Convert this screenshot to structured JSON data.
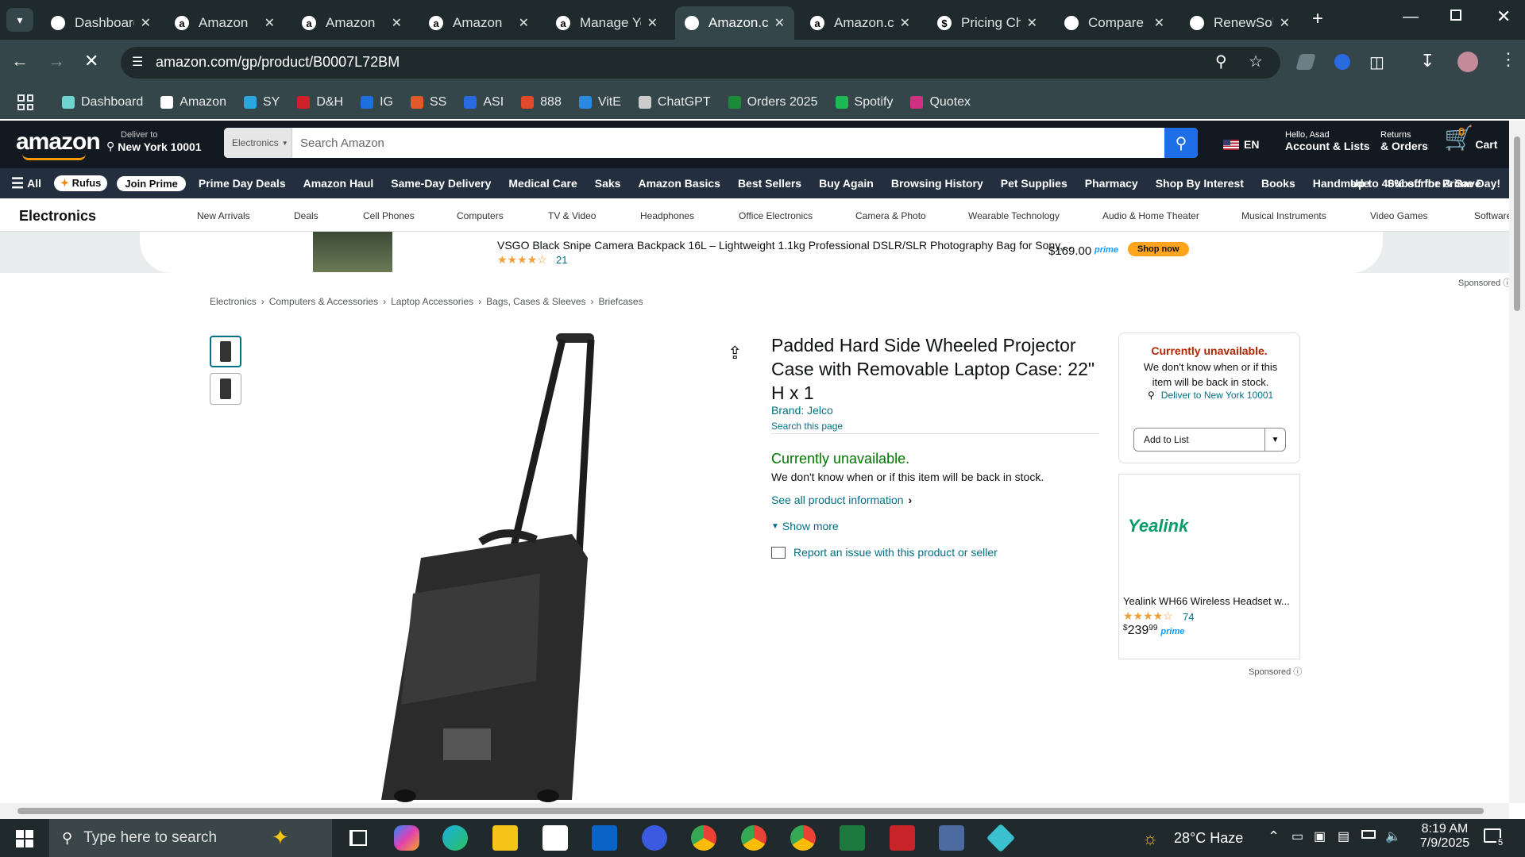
{
  "browser": {
    "tabs": [
      {
        "title": "Dashboard",
        "icon": "dashboard-icon"
      },
      {
        "title": "Amazon",
        "icon": "amazon-icon"
      },
      {
        "title": "Amazon",
        "icon": "amazon-icon"
      },
      {
        "title": "Amazon",
        "icon": "amazon-icon"
      },
      {
        "title": "Manage Yo",
        "icon": "amazon-icon"
      },
      {
        "title": "Amazon.co",
        "icon": "loading-icon"
      },
      {
        "title": "Amazon.co",
        "icon": "amazon-icon"
      },
      {
        "title": "Pricing Ch",
        "icon": "dollar-icon"
      },
      {
        "title": "Compare (",
        "icon": "compare-icon"
      },
      {
        "title": "RenewSolu",
        "icon": "ec-icon"
      }
    ],
    "active_tab_index": 5,
    "url": "amazon.com/gp/product/B0007L72BM",
    "bookmarks": [
      {
        "label": "Dashboard",
        "color": "#6fd3d0"
      },
      {
        "label": "Amazon",
        "color": "#ffffff"
      },
      {
        "label": "SY",
        "color": "#2aa7df"
      },
      {
        "label": "D&H",
        "color": "#d0202a"
      },
      {
        "label": "IG",
        "color": "#1e6ee0"
      },
      {
        "label": "SS",
        "color": "#e05a2a"
      },
      {
        "label": "ASI",
        "color": "#2a6ae0"
      },
      {
        "label": "888",
        "color": "#e04a2a"
      },
      {
        "label": "VitE",
        "color": "#2a8ae0"
      },
      {
        "label": "ChatGPT",
        "color": "#cccccc"
      },
      {
        "label": "Orders 2025",
        "color": "#1d8a3a"
      },
      {
        "label": "Spotify",
        "color": "#1db954"
      },
      {
        "label": "Quotex",
        "color": "#d03080"
      }
    ]
  },
  "amazon": {
    "logo": "amazon",
    "deliver_label": "Deliver to",
    "deliver_location": "New York 10001",
    "search_category": "Electronics",
    "search_placeholder": "Search Amazon",
    "language": "EN",
    "account_hello": "Hello, Asad",
    "account_label": "Account & Lists",
    "returns_label": "Returns",
    "orders_label": "& Orders",
    "cart_count": "0",
    "cart_label": "Cart",
    "nav_all": "All",
    "nav_rufus": "Rufus",
    "nav_join_prime": "Join Prime",
    "nav_items": [
      "Prime Day Deals",
      "Amazon Haul",
      "Same-Day Delivery",
      "Medical Care",
      "Saks",
      "Amazon Basics",
      "Best Sellers",
      "Buy Again",
      "Browsing History",
      "Pet Supplies",
      "Pharmacy",
      "Shop By Interest",
      "Books",
      "Handmade",
      "Subscribe & Save"
    ],
    "nav_promo": "Up to 40% off for Prime Day!",
    "subnav_title": "Electronics",
    "subnav_items": [
      "New Arrivals",
      "Deals",
      "Cell Phones",
      "Computers",
      "TV & Video",
      "Headphones",
      "Office Electronics",
      "Camera & Photo",
      "Wearable Technology",
      "Audio & Home Theater",
      "Musical Instruments",
      "Video Games",
      "Software"
    ],
    "ad_banner": {
      "title": "VSGO Black Snipe Camera Backpack 16L – Lightweight 1.1kg Professional DSLR/SLR Photography Bag for Sony,...",
      "rating": 4,
      "reviews": "21",
      "price": "$169.00",
      "prime": "prime",
      "cta": "Shop now",
      "sponsored": "Sponsored"
    },
    "breadcrumbs": [
      "Electronics",
      "Computers & Accessories",
      "Laptop Accessories",
      "Bags, Cases & Sleeves",
      "Briefcases"
    ],
    "product": {
      "title": "Padded Hard Side Wheeled Projector Case with Removable Laptop Case: 22\" H x 1",
      "brand": "Brand: Jelco",
      "search_page": "Search this page",
      "availability": "Currently unavailable.",
      "availability_note": "We don't know when or if this item will be back in stock.",
      "see_all": "See all product information",
      "show_more": "Show more",
      "report": "Report an issue with this product or seller"
    },
    "buybox": {
      "status": "Currently unavailable.",
      "note": "We don't know when or if this item will be back in stock.",
      "deliver": "Deliver to New York 10001",
      "add_to_list": "Add to List"
    },
    "side_ad": {
      "brand": "Yealink",
      "title": "Yealink WH66 Wireless Headset w...",
      "rating": 4,
      "reviews": "74",
      "price_dollar": "$",
      "price_whole": "239",
      "price_cents": "99",
      "prime": "prime",
      "sponsored": "Sponsored"
    }
  },
  "taskbar": {
    "search_placeholder": "Type here to search",
    "weather": "28°C Haze",
    "time": "8:19 AM",
    "date": "7/9/2025",
    "notifications": "5"
  }
}
